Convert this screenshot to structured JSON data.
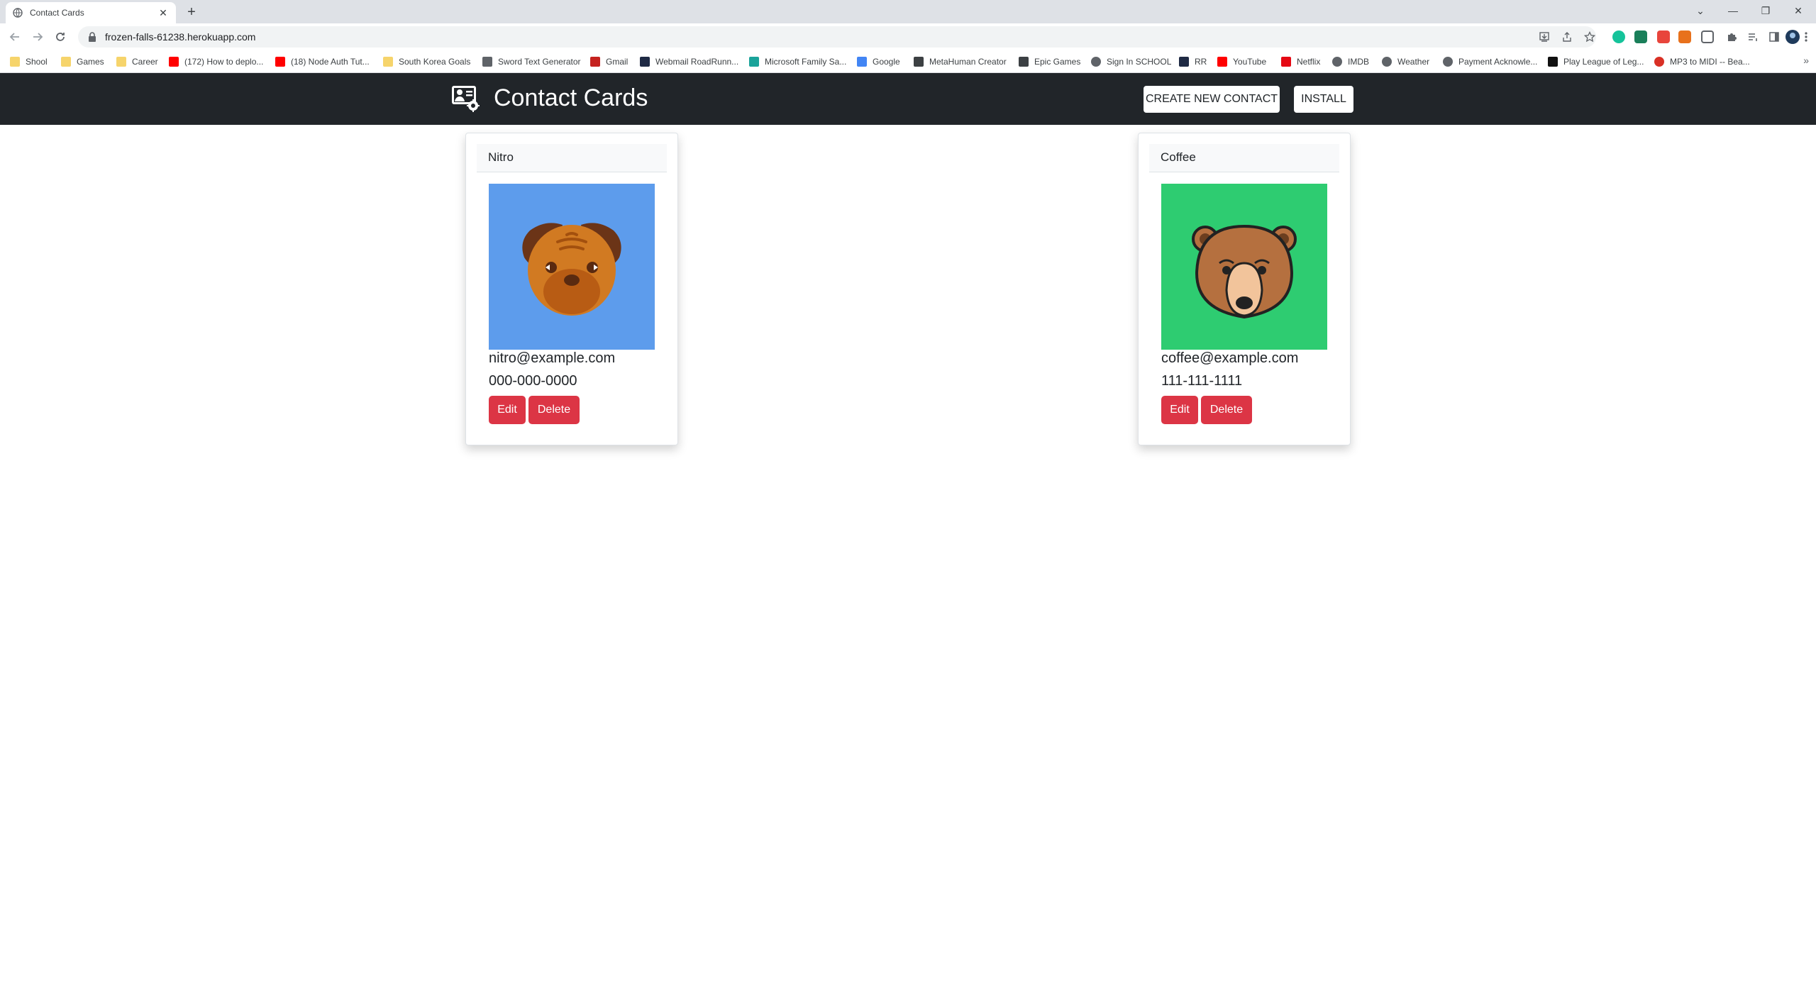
{
  "browser": {
    "tab_title": "Contact Cards",
    "url": "frozen-falls-61238.herokuapp.com",
    "bookmarks": [
      {
        "label": "Shool",
        "icon": "folder-icon",
        "color": "#f6d46b"
      },
      {
        "label": "Games",
        "icon": "folder-icon",
        "color": "#f6d46b"
      },
      {
        "label": "Career",
        "icon": "folder-icon",
        "color": "#f6d46b"
      },
      {
        "label": "(172) How to deplo...",
        "icon": "youtube-icon",
        "color": "#ff0000"
      },
      {
        "label": "(18) Node Auth Tut...",
        "icon": "youtube-icon",
        "color": "#ff0000"
      },
      {
        "label": "South Korea Goals",
        "icon": "folder-icon",
        "color": "#f6d46b"
      },
      {
        "label": "Sword Text Generator",
        "icon": "sword-icon",
        "color": "#5f6368"
      },
      {
        "label": "Gmail",
        "icon": "gmail-icon",
        "color": "#c5221f"
      },
      {
        "label": "Webmail RoadRunn...",
        "icon": "webmail-icon",
        "color": "#1f2a44"
      },
      {
        "label": "Microsoft Family Sa...",
        "icon": "heart-icon",
        "color": "#1aa39a"
      },
      {
        "label": "Google",
        "icon": "google-icon",
        "color": "#4285f4"
      },
      {
        "label": "MetaHuman Creator",
        "icon": "metahuman-icon",
        "color": "#3c4043"
      },
      {
        "label": "Epic Games",
        "icon": "epic-games-icon",
        "color": "#3c4043"
      },
      {
        "label": "Sign In SCHOOL",
        "icon": "globe-icon",
        "color": "#5f6368"
      },
      {
        "label": "RR",
        "icon": "webmail-icon",
        "color": "#1f2a44"
      },
      {
        "label": "YouTube",
        "icon": "youtube-icon",
        "color": "#ff0000"
      },
      {
        "label": "Netflix",
        "icon": "netflix-icon",
        "color": "#e50914"
      },
      {
        "label": "IMDB",
        "icon": "globe-icon",
        "color": "#5f6368"
      },
      {
        "label": "Weather",
        "icon": "globe-icon",
        "color": "#5f6368"
      },
      {
        "label": "Payment Acknowle...",
        "icon": "globe-icon",
        "color": "#5f6368"
      },
      {
        "label": "Play League of Leg...",
        "icon": "lol-icon",
        "color": "#111111"
      },
      {
        "label": "MP3 to MIDI -- Bea...",
        "icon": "mp3-icon",
        "color": "#d93025"
      }
    ]
  },
  "app": {
    "brand": "Contact Cards",
    "create_button": "CREATE NEW CONTACT",
    "install_button": "INSTALL",
    "colors": {
      "navbar": "#212529",
      "danger": "#dc3545"
    }
  },
  "contacts": [
    {
      "name": "Nitro",
      "email": "nitro@example.com",
      "phone": "000-000-0000",
      "avatar": "pug-face-icon",
      "avatar_bg": "#5d9cec",
      "edit_label": "Edit",
      "delete_label": "Delete"
    },
    {
      "name": "Coffee",
      "email": "coffee@example.com",
      "phone": "111-111-1111",
      "avatar": "bear-face-icon",
      "avatar_bg": "#2ecc71",
      "edit_label": "Edit",
      "delete_label": "Delete"
    }
  ]
}
